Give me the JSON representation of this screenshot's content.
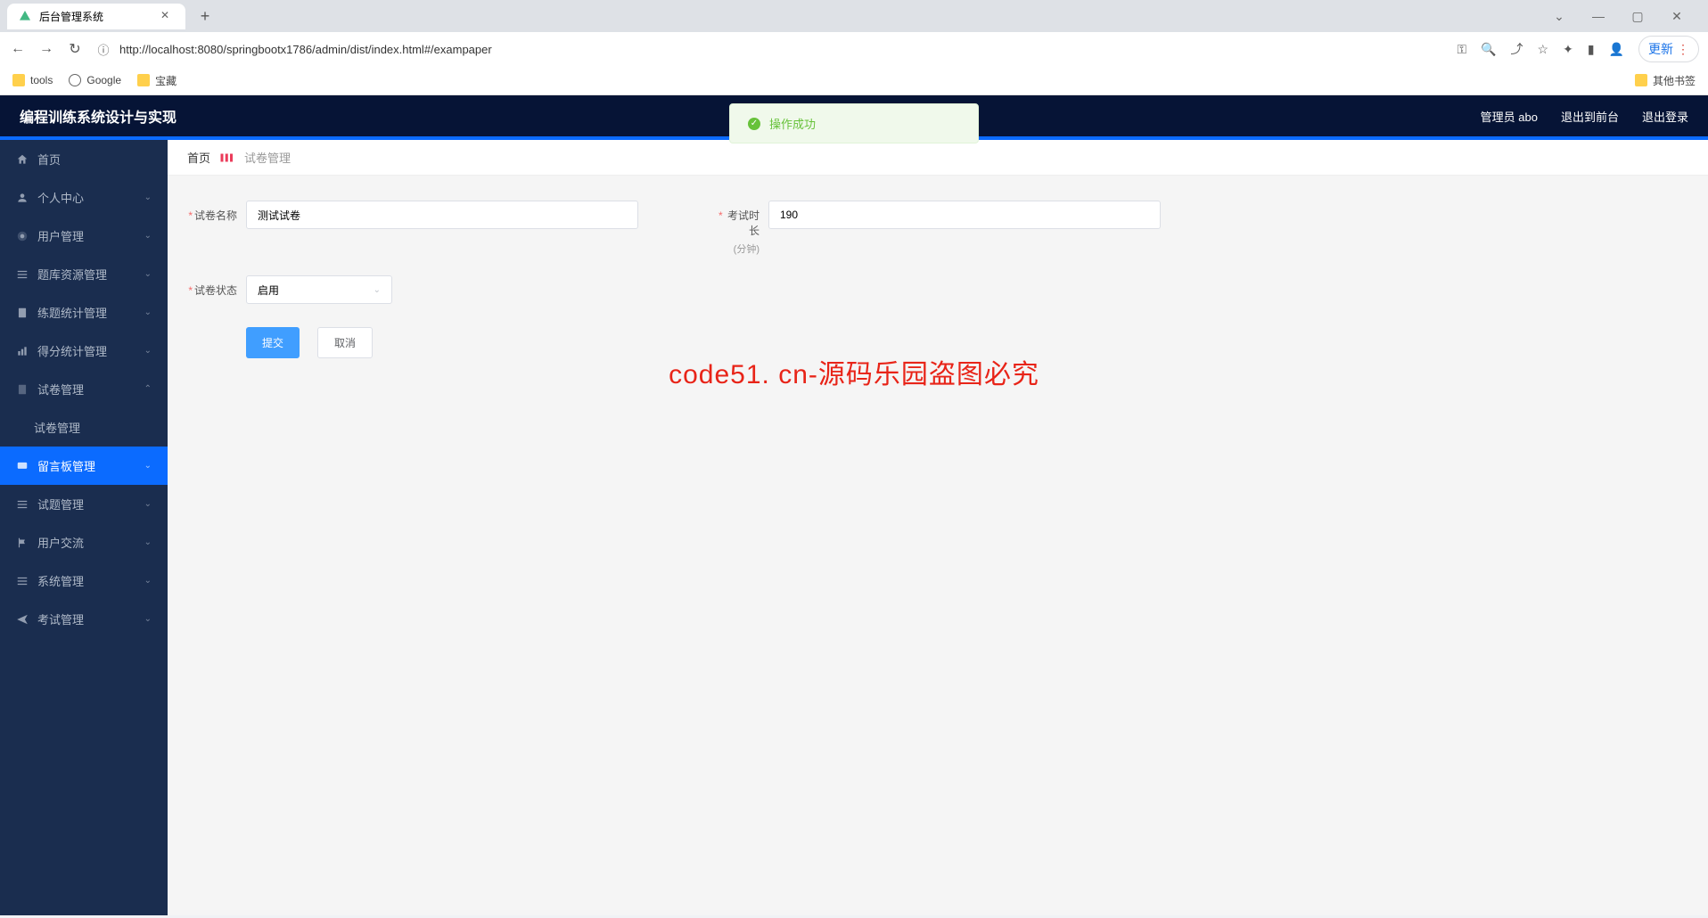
{
  "browser": {
    "tab_title": "后台管理系统",
    "url": "http://localhost:8080/springbootx1786/admin/dist/index.html#/exampaper",
    "update_label": "更新",
    "bookmarks": {
      "tools": "tools",
      "google": "Google",
      "treasure": "宝藏",
      "other": "其他书签"
    }
  },
  "header": {
    "title": "编程训练系统设计与实现",
    "admin": "管理员 abo",
    "to_front": "退出到前台",
    "logout": "退出登录"
  },
  "toast": {
    "text": "操作成功"
  },
  "sidebar": {
    "home": "首页",
    "personal": "个人中心",
    "user_mgmt": "用户管理",
    "question_bank": "题库资源管理",
    "practice_stats": "练题统计管理",
    "score_stats": "得分统计管理",
    "paper_mgmt": "试卷管理",
    "paper_mgmt_sub": "试卷管理",
    "message_board": "留言板管理",
    "question_mgmt": "试题管理",
    "user_comm": "用户交流",
    "system_mgmt": "系统管理",
    "exam_mgmt": "考试管理"
  },
  "breadcrumb": {
    "home": "首页",
    "current": "试卷管理"
  },
  "form": {
    "paper_name_label": "试卷名称",
    "paper_name_value": "测试试卷",
    "duration_label": "考试时长",
    "duration_sub": "(分钟)",
    "duration_value": "190",
    "status_label": "试卷状态",
    "status_value": "启用",
    "submit": "提交",
    "cancel": "取消"
  },
  "watermark": {
    "main": "code51. cn-源码乐园盗图必究",
    "bg": "code51.cn"
  }
}
